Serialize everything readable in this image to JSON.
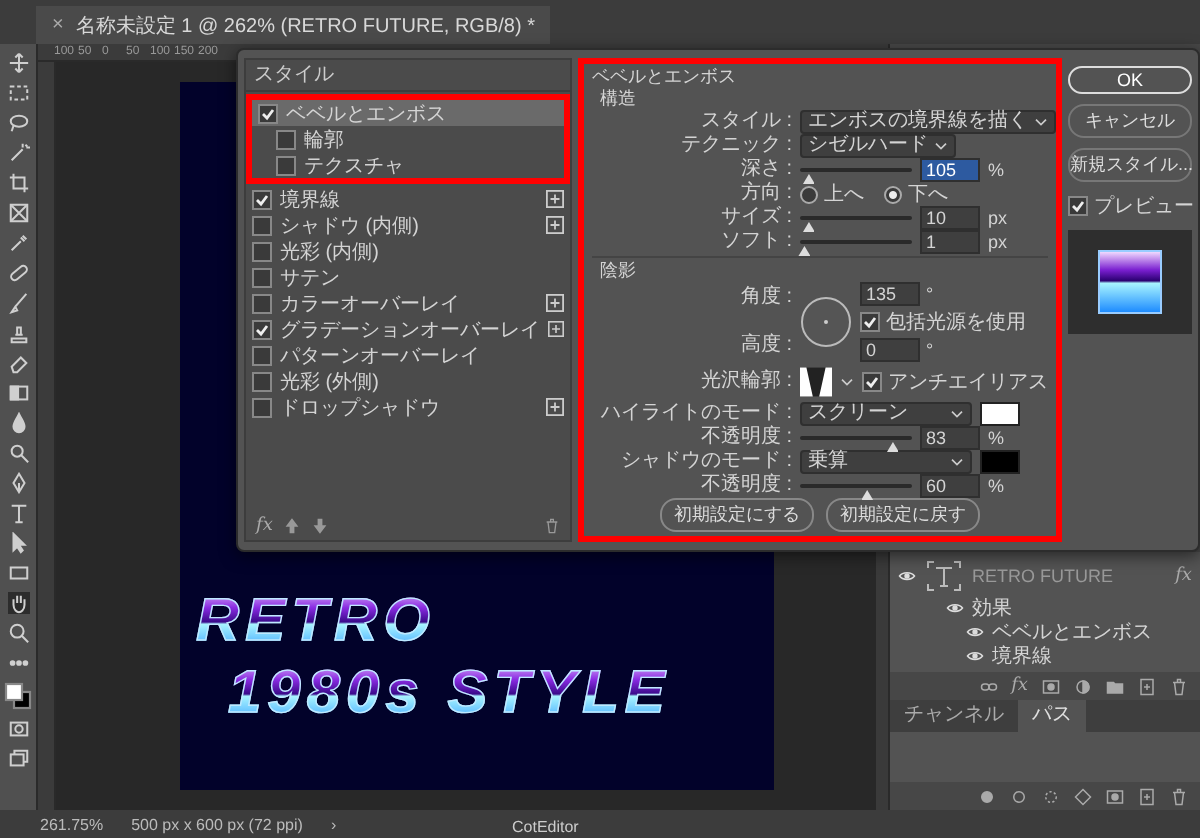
{
  "document_tab": {
    "close": "×",
    "title": "名称未設定 1 @ 262% (RETRO FUTURE, RGB/8) *"
  },
  "ruler_ticks": [
    "100",
    "50",
    "0",
    "50",
    "100",
    "150",
    "200"
  ],
  "canvas": {
    "lines": [
      "RETRO",
      "1980s STYLE"
    ]
  },
  "dialog": {
    "styles": {
      "title": "スタイル",
      "footer_fx": "fx",
      "items": [
        {
          "label": "ベベルとエンボス",
          "checked": true,
          "selected": true,
          "plus": false,
          "children": [
            {
              "label": "輪郭",
              "checked": false,
              "selected": false,
              "plus": false
            },
            {
              "label": "テクスチャ",
              "checked": false,
              "selected": false,
              "plus": false
            }
          ]
        },
        {
          "label": "境界線",
          "checked": true,
          "selected": false,
          "plus": true
        },
        {
          "label": "シャドウ (内側)",
          "checked": false,
          "selected": false,
          "plus": true
        },
        {
          "label": "光彩 (内側)",
          "checked": false,
          "selected": false,
          "plus": false
        },
        {
          "label": "サテン",
          "checked": false,
          "selected": false,
          "plus": false
        },
        {
          "label": "カラーオーバーレイ",
          "checked": false,
          "selected": false,
          "plus": true
        },
        {
          "label": "グラデーションオーバーレイ",
          "checked": true,
          "selected": false,
          "plus": true
        },
        {
          "label": "パターンオーバーレイ",
          "checked": false,
          "selected": false,
          "plus": false
        },
        {
          "label": "光彩 (外側)",
          "checked": false,
          "selected": false,
          "plus": false
        },
        {
          "label": "ドロップシャドウ",
          "checked": false,
          "selected": false,
          "plus": true
        }
      ]
    },
    "settings": {
      "title": "ベベルとエンボス",
      "structure": {
        "heading": "構造",
        "style": {
          "label": "スタイル :",
          "value": "エンボスの境界線を描く"
        },
        "technique": {
          "label": "テクニック :",
          "value": "シゼルハード"
        },
        "depth": {
          "label": "深さ :",
          "level": 0.08,
          "value": "105",
          "unit": "%"
        },
        "direction": {
          "label": "方向 :",
          "options": [
            {
              "label": "上へ",
              "selected": false
            },
            {
              "label": "下へ",
              "selected": true
            }
          ]
        },
        "size": {
          "label": "サイズ :",
          "level": 0.08,
          "value": "10",
          "unit": "px"
        },
        "soften": {
          "label": "ソフト :",
          "level": 0.04,
          "value": "1",
          "unit": "px"
        }
      },
      "shading": {
        "heading": "陰影",
        "angle": {
          "label": "角度 :",
          "value": "135",
          "unit": "°"
        },
        "global_light": {
          "label": "包括光源を使用",
          "checked": true
        },
        "altitude": {
          "label": "高度 :",
          "value": "0",
          "unit": "°"
        },
        "gloss": {
          "label": "光沢輪郭 :"
        },
        "anti_alias": {
          "label": "アンチエイリアス",
          "checked": true
        },
        "highlight": {
          "label": "ハイライトのモード :",
          "value": "スクリーン",
          "color": "#ffffff"
        },
        "highlight_opacity": {
          "label": "不透明度 :",
          "level": 0.83,
          "value": "83",
          "unit": "%"
        },
        "shadow": {
          "label": "シャドウのモード :",
          "value": "乗算",
          "color": "#000000"
        },
        "shadow_opacity": {
          "label": "不透明度 :",
          "level": 0.6,
          "value": "60",
          "unit": "%"
        }
      },
      "reset_buttons": [
        "初期設定にする",
        "初期設定に戻す"
      ]
    },
    "buttons": [
      {
        "label": "OK",
        "default": true
      },
      {
        "label": "キャンセル",
        "default": false
      },
      {
        "label": "新規スタイル...",
        "default": false
      }
    ],
    "preview": {
      "label": "プレビュー",
      "checked": true
    }
  },
  "layers": {
    "layer": {
      "name": "RETRO FUTURE",
      "fx": "fx"
    },
    "effects_label": "効果",
    "effects": [
      "ベベルとエンボス",
      "境界線"
    ],
    "toolbar_fx": "fx"
  },
  "panel_tabs": [
    {
      "label": "チャンネル",
      "selected": false
    },
    {
      "label": "パス",
      "selected": true
    }
  ],
  "status_bar": {
    "zoom": "261.75%",
    "doc_size": "500 px x 600 px (72 ppi)",
    "arrow": "›"
  },
  "dock_tooltip": "CotEditor"
}
